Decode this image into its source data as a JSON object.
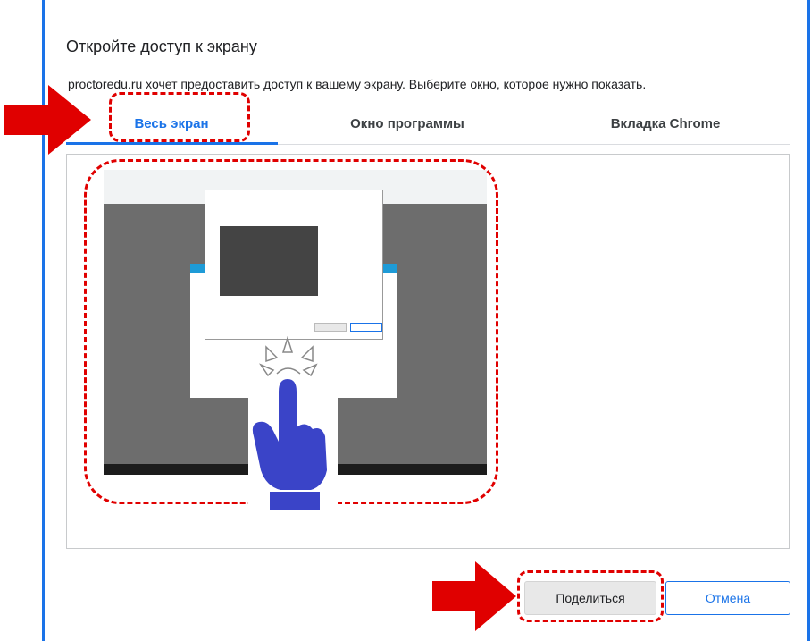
{
  "dialog": {
    "title": "Откройте доступ к экрану",
    "subtitle": "proctoredu.ru хочет предоставить доступ к вашему экрану. Выберите окно, которое нужно показать."
  },
  "tabs": [
    {
      "label": "Весь экран",
      "active": true
    },
    {
      "label": "Окно программы",
      "active": false
    },
    {
      "label": "Вкладка Chrome",
      "active": false
    }
  ],
  "buttons": {
    "share": "Поделиться",
    "cancel": "Отмена"
  },
  "colors": {
    "accent": "#1a73e8",
    "annotation": "#e00000",
    "hand": "#3a44c8"
  },
  "icons": [
    "screen-thumbnail",
    "red-arrow",
    "pointing-hand-icon"
  ]
}
